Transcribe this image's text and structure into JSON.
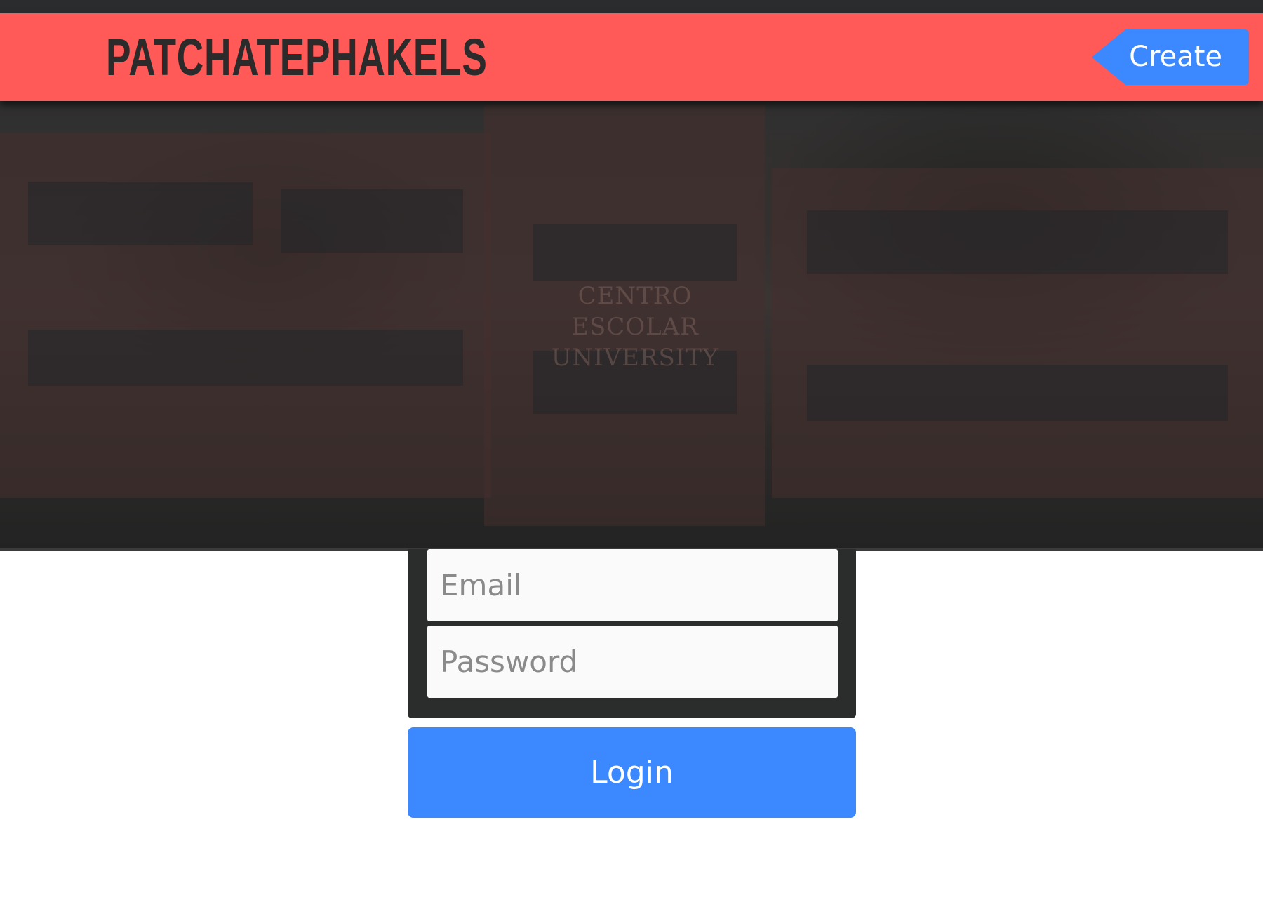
{
  "header": {
    "brand": "PATCHATEPHAKELS",
    "create_label": "Create"
  },
  "hero": {
    "sign_line1": "CENTRO ESCOLAR",
    "sign_line2": "UNIVERSITY"
  },
  "login": {
    "email_placeholder": "Email",
    "password_placeholder": "Password",
    "login_label": "Login"
  },
  "colors": {
    "header_bg": "#ff5a58",
    "accent": "#3b88ff",
    "form_bg": "#2b2c2c"
  }
}
